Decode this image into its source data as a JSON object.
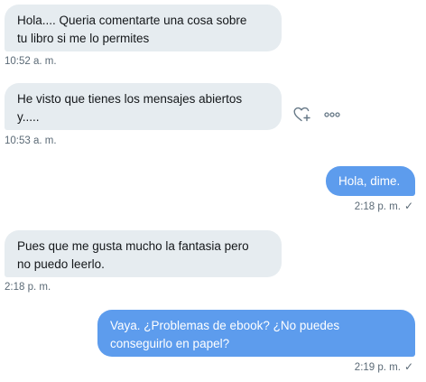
{
  "messages": [
    {
      "direction": "in",
      "text": "Hola.... Queria comentarte una cosa sobre\ntu libro si me lo permites",
      "time": "10:52 a. m."
    },
    {
      "direction": "in",
      "text": "He visto que tienes los mensajes abiertos\ny.....",
      "time": "10:53 a. m."
    },
    {
      "direction": "out",
      "text": "Hola, dime.",
      "time": "2:18 p. m.",
      "status": "✓"
    },
    {
      "direction": "in",
      "text": "Pues que me gusta mucho la fantasia pero\nno puedo leerlo.",
      "time": "2:18 p. m."
    },
    {
      "direction": "out",
      "text": "Vaya. ¿Problemas de ebook? ¿No puedes\nconseguirlo en papel?",
      "time": "2:19 p. m.",
      "status": "✓"
    }
  ],
  "icons": {
    "react": "heart-plus-icon",
    "more": "more-options-icon"
  },
  "colors": {
    "incoming_bubble": "#e6ecf0",
    "outgoing_bubble": "#5d9ced",
    "timestamp": "#5b6a76"
  }
}
